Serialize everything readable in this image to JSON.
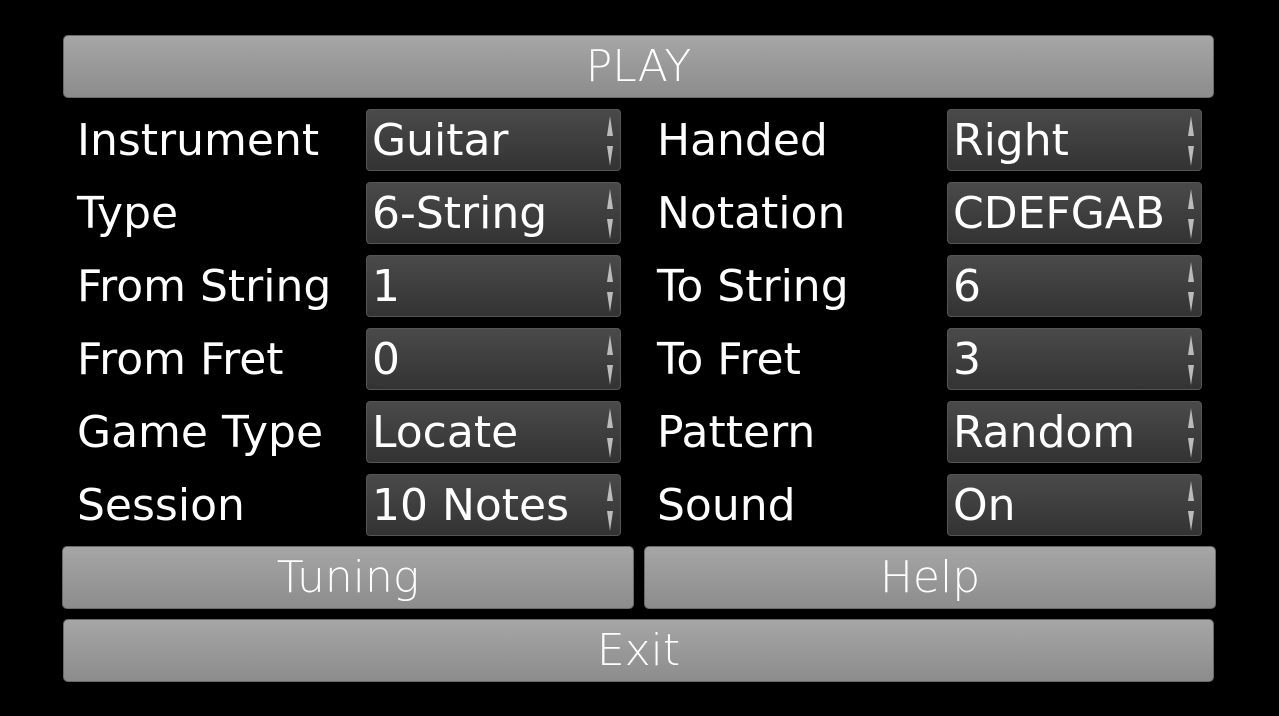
{
  "buttons": {
    "play": "PLAY",
    "tuning": "Tuning",
    "help": "Help",
    "exit": "Exit"
  },
  "left_settings": [
    {
      "label": "Instrument",
      "value": "Guitar"
    },
    {
      "label": "Type",
      "value": "6-String"
    },
    {
      "label": "From String",
      "value": "1"
    },
    {
      "label": "From Fret",
      "value": "0"
    },
    {
      "label": "Game Type",
      "value": "Locate"
    },
    {
      "label": "Session",
      "value": "10 Notes"
    }
  ],
  "right_settings": [
    {
      "label": "Handed",
      "value": "Right"
    },
    {
      "label": "Notation",
      "value": "CDEFGAB"
    },
    {
      "label": "To String",
      "value": "6"
    },
    {
      "label": "To Fret",
      "value": "3"
    },
    {
      "label": "Pattern",
      "value": "Random"
    },
    {
      "label": "Sound",
      "value": "On"
    }
  ]
}
